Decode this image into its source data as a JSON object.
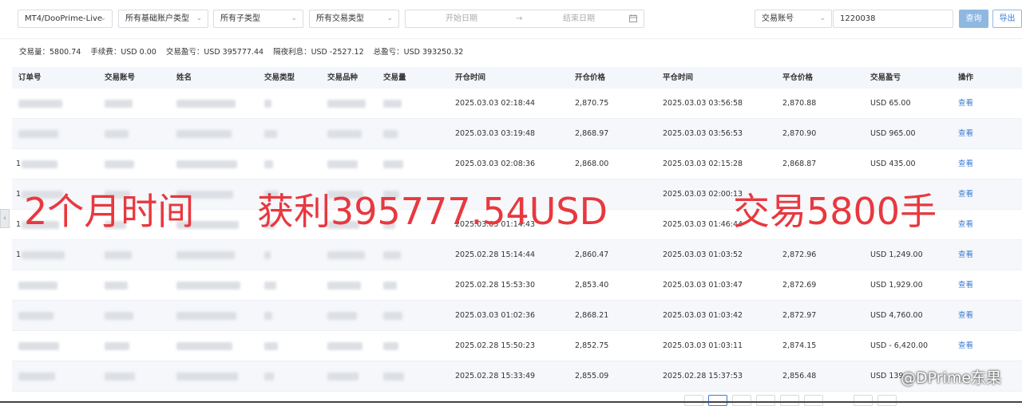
{
  "filters": {
    "server": "MT4/DooPrime-Live",
    "account_type": "所有基础账户类型",
    "sub_type": "所有子类型",
    "trade_type": "所有交易类型",
    "start_date_placeholder": "开始日期",
    "date_arrow": "→",
    "end_date_placeholder": "结束日期",
    "search_field": "交易账号",
    "search_value": "1220038",
    "query_label": "查询",
    "export_label": "导出"
  },
  "summary": {
    "volume": "交易量：5800.74",
    "fee": "手续费：USD 0.00",
    "trade_pnl": "交易盈亏：USD 395777.44",
    "swap": "隔夜利息：USD -2527.12",
    "total_pnl": "总盈亏：USD 393250.32"
  },
  "table": {
    "headers": [
      "订单号",
      "交易账号",
      "姓名",
      "交易类型",
      "交易品种",
      "交易量",
      "开仓时间",
      "开仓价格",
      "平仓时间",
      "平仓价格",
      "交易盈亏",
      "操作"
    ],
    "rows": [
      {
        "order_prefix": "",
        "open_time": "2025.03.03 02:18:44",
        "open_price": "2,870.75",
        "close_time": "2025.03.03 03:56:58",
        "close_price": "2,870.88",
        "pnl": "USD 65.00",
        "action": "查看"
      },
      {
        "order_prefix": "",
        "open_time": "2025.03.03 03:19:48",
        "open_price": "2,868.97",
        "close_time": "2025.03.03 03:56:53",
        "close_price": "2,870.90",
        "pnl": "USD 965.00",
        "action": "查看"
      },
      {
        "order_prefix": "1",
        "open_time": "2025.03.03 02:08:36",
        "open_price": "2,868.00",
        "close_time": "2025.03.03 02:15:28",
        "close_price": "2,868.87",
        "pnl": "USD 435.00",
        "action": "查看"
      },
      {
        "order_prefix": "1",
        "open_time": "",
        "open_price": "",
        "close_time": "2025.03.03 02:00:13",
        "close_price": "",
        "pnl": "",
        "action": "查看"
      },
      {
        "order_prefix": "1",
        "open_time": "2025.03.03 01:14:43",
        "open_price": "",
        "close_time": "2025.03.03 01:46:44",
        "close_price": "",
        "pnl": "",
        "action": "查看"
      },
      {
        "order_prefix": "1",
        "open_time": "2025.02.28 15:14:44",
        "open_price": "2,860.47",
        "close_time": "2025.03.03 01:03:52",
        "close_price": "2,872.96",
        "pnl": "USD 1,249.00",
        "action": "查看"
      },
      {
        "order_prefix": "",
        "open_time": "2025.02.28 15:53:30",
        "open_price": "2,853.40",
        "close_time": "2025.03.03 01:03:47",
        "close_price": "2,872.69",
        "pnl": "USD 1,929.00",
        "action": "查看"
      },
      {
        "order_prefix": "",
        "open_time": "2025.03.03 01:02:36",
        "open_price": "2,868.21",
        "close_time": "2025.03.03 01:03:42",
        "close_price": "2,872.97",
        "pnl": "USD 4,760.00",
        "action": "查看"
      },
      {
        "order_prefix": "",
        "open_time": "2025.02.28 15:50:23",
        "open_price": "2,852.75",
        "close_time": "2025.03.03 01:03:11",
        "close_price": "2,874.15",
        "pnl": "USD - 6,420.00",
        "action": "查看"
      },
      {
        "order_prefix": "",
        "open_time": "2025.02.28 15:33:49",
        "open_price": "2,855.09",
        "close_time": "2025.02.28 15:37:53",
        "close_price": "2,856.48",
        "pnl": "USD 139",
        "action": ""
      }
    ]
  },
  "overlay": {
    "part1": "2个月时间",
    "part2": "获利395777.54USD",
    "part3": "交易5800手"
  },
  "watermark": "@DPrime东果",
  "colors": {
    "accent": "#3a7bd5",
    "query_button": "#8fb8e0",
    "overlay_text": "#e8383f",
    "header_bg": "#f3f6fa"
  }
}
